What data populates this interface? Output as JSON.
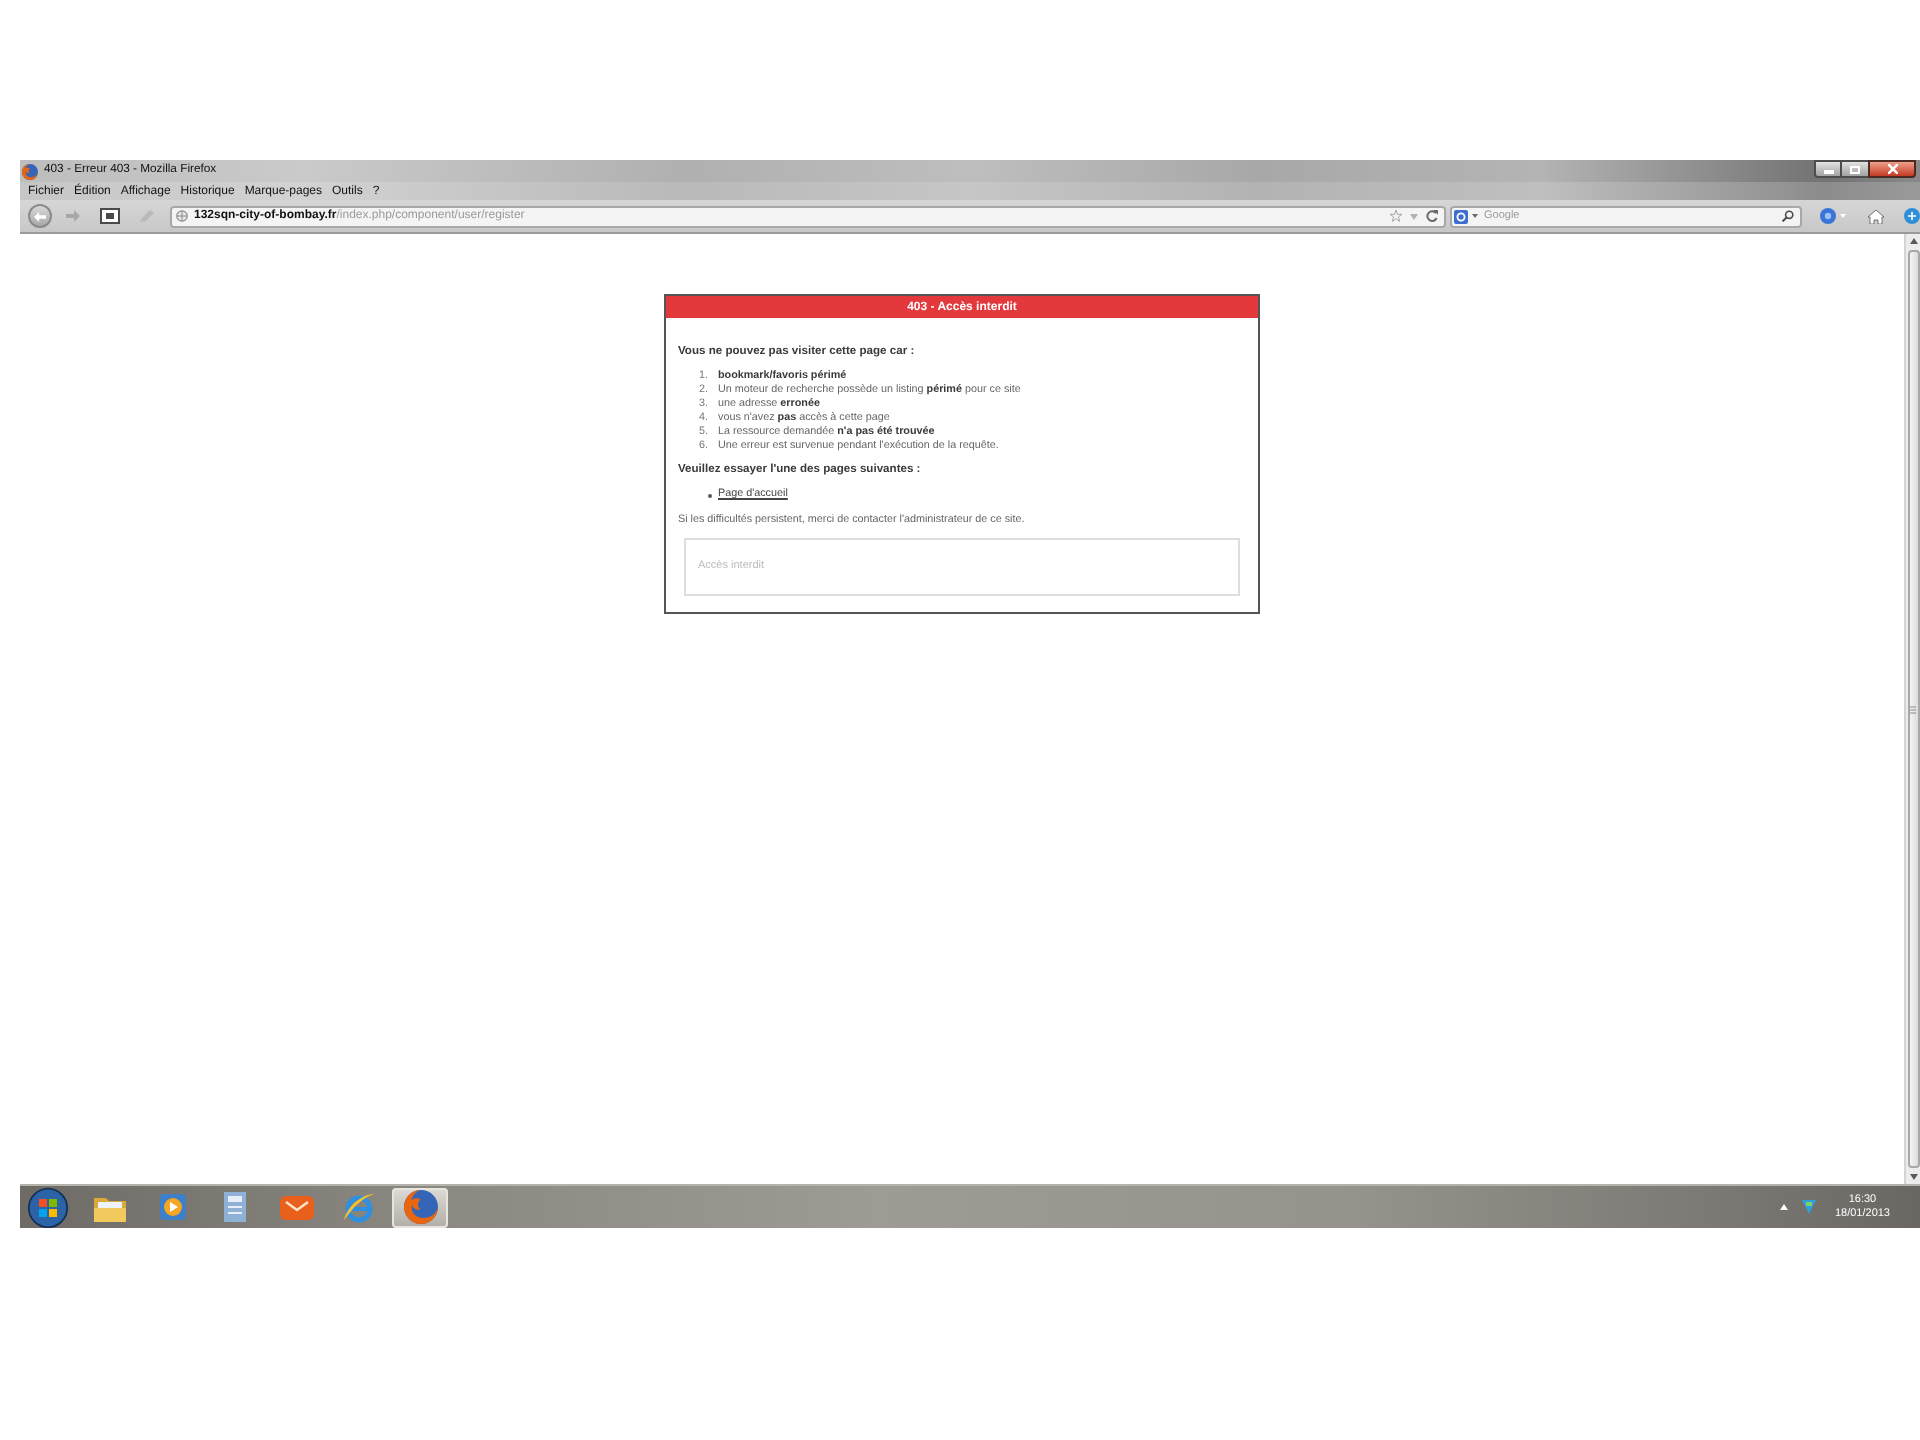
{
  "window": {
    "title": "403 - Erreur 403 - Mozilla Firefox"
  },
  "menu_bar": [
    "Fichier",
    "Édition",
    "Affichage",
    "Historique",
    "Marque-pages",
    "Outils",
    "?"
  ],
  "address_bar": {
    "url": "**132sqn-city-of-bombay.fr**/index.php/component/user/register"
  },
  "search_field": {
    "placeholder": "Google"
  },
  "error_box": {
    "title": "403 - Accès interdit",
    "intro": "Vous ne pouvez pas visiter cette page car :",
    "reasons": [
      {
        "number": "1.",
        "text": "bookmark/favoris périmé",
        "bold": true
      },
      {
        "number": "2.",
        "text": "Un moteur de recherche possède un listing **périmé** pour ce site",
        "bold": false
      },
      {
        "number": "3.",
        "text": "une adresse **erronée**",
        "bold": false
      },
      {
        "number": "4.",
        "text": "vous n'avez **pas** accès à cette page",
        "bold": false
      },
      {
        "number": "5.",
        "text": "La ressource demandée **n'a pas été trouvée**",
        "bold": false
      },
      {
        "number": "6.",
        "text": "Une erreur est survenue pendant l'exécution de la requête.",
        "bold": false
      }
    ],
    "suggestion": "Veuillez essayer l'une des pages suivantes :",
    "links": [
      "Page d'accueil"
    ],
    "contact": "Si les difficultés persistent, merci de contacter l'administrateur de ce site.",
    "message": "Accès interdit"
  },
  "taskbar": {
    "apps": [
      {
        "kind": "folder",
        "selected": false
      },
      {
        "kind": "media",
        "selected": false
      },
      {
        "kind": "document",
        "selected": false
      },
      {
        "kind": "mail",
        "selected": false
      },
      {
        "kind": "ie",
        "selected": false
      },
      {
        "kind": "firefox",
        "selected": true
      }
    ],
    "clock": {
      "time": "16:30",
      "date": "18/01/2013"
    }
  }
}
